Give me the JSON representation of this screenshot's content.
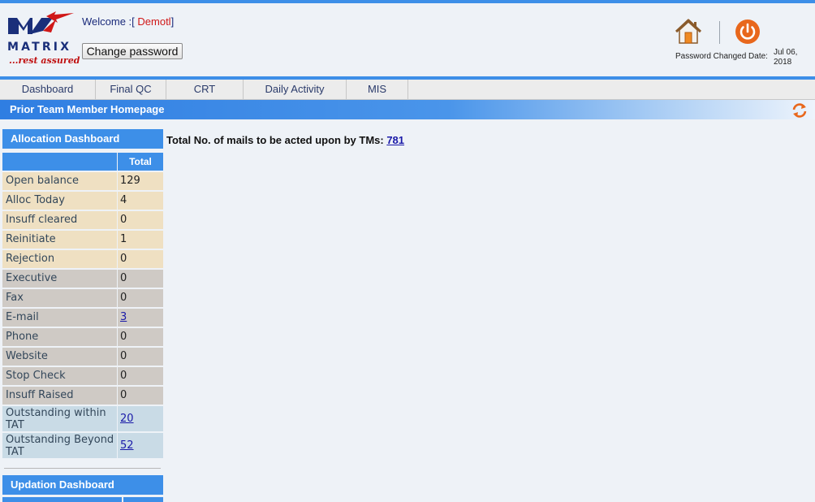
{
  "header": {
    "logo": {
      "text": "MATRIX",
      "tagline": "...rest assured"
    },
    "welcome_prefix": "Welcome :[",
    "username": " Demotl",
    "welcome_suffix": "]",
    "change_password_label": "Change password",
    "home_icon": "home-icon",
    "power_icon": "power-icon",
    "password_changed_label": "Password Changed Date:",
    "password_changed_date": "Jul 06, 2018"
  },
  "nav": {
    "items": [
      {
        "label": "Dashboard"
      },
      {
        "label": "Final QC"
      },
      {
        "label": "CRT"
      },
      {
        "label": "Daily Activity"
      },
      {
        "label": "MIS"
      }
    ]
  },
  "page": {
    "title": "Prior Team Member Homepage",
    "refresh_icon": "refresh-icon"
  },
  "allocation": {
    "title": "Allocation Dashboard",
    "total_header": "Total",
    "rows": [
      {
        "label": "Open balance",
        "value": "129",
        "link": false
      },
      {
        "label": "Alloc Today",
        "value": "4",
        "link": false
      },
      {
        "label": "Insuff cleared",
        "value": "0",
        "link": false
      },
      {
        "label": "Reinitiate",
        "value": "1",
        "link": false
      },
      {
        "label": "Rejection",
        "value": "0",
        "link": false
      },
      {
        "label": "Executive",
        "value": "0",
        "link": false
      },
      {
        "label": "Fax",
        "value": "0",
        "link": false
      },
      {
        "label": "E-mail",
        "value": "3",
        "link": true
      },
      {
        "label": "Phone",
        "value": "0",
        "link": false
      },
      {
        "label": "Website",
        "value": "0",
        "link": false
      },
      {
        "label": "Stop Check",
        "value": "0",
        "link": false
      },
      {
        "label": "Insuff Raised",
        "value": "0",
        "link": false
      },
      {
        "label": "Outstanding within TAT",
        "value": "20",
        "link": true
      },
      {
        "label": "Outstanding Beyond TAT",
        "value": "52",
        "link": true
      }
    ]
  },
  "updation": {
    "title": "Updation Dashboard"
  },
  "main": {
    "mails_label": "Total No. of mails to be acted upon by TMs: ",
    "mails_count": "781"
  },
  "colors": {
    "accent": "#3d8fe8",
    "row_tan": "#efe0c2",
    "row_gray": "#cfcac5",
    "row_blue": "#c9dbe6",
    "link": "#1a1aa8",
    "power": "#e8671c"
  }
}
